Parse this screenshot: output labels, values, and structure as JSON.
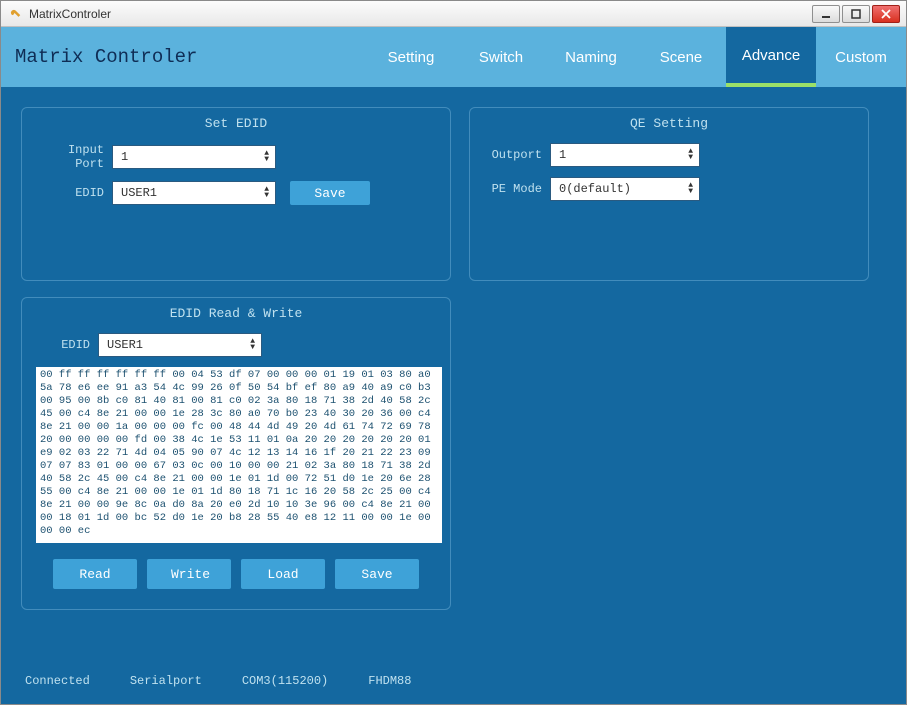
{
  "window": {
    "title": "MatrixControler"
  },
  "brand": "Matrix Controler",
  "tabs": [
    {
      "label": "Setting",
      "active": false
    },
    {
      "label": "Switch",
      "active": false
    },
    {
      "label": "Naming",
      "active": false
    },
    {
      "label": "Scene",
      "active": false
    },
    {
      "label": "Advance",
      "active": true
    },
    {
      "label": "Custom",
      "active": false
    }
  ],
  "set_edid": {
    "title": "Set EDID",
    "input_port_label": "Input Port",
    "input_port_value": "1",
    "edid_label": "EDID",
    "edid_value": "USER1",
    "save_label": "Save"
  },
  "qe": {
    "title": "QE Setting",
    "outport_label": "Outport",
    "outport_value": "1",
    "pe_mode_label": "PE Mode",
    "pe_mode_value": "0(default)"
  },
  "rw": {
    "title": "EDID Read & Write",
    "edid_label": "EDID",
    "edid_value": "USER1",
    "hex": "00 ff ff ff ff ff ff 00 04 53 df 07 00 00 00 01 19 01 03 80 a0 5a 78 e6 ee 91 a3 54 4c 99 26 0f 50 54 bf ef 80 a9 40 a9 c0 b3 00 95 00 8b c0 81 40 81 00 81 c0 02 3a 80 18 71 38 2d 40 58 2c 45 00 c4 8e 21 00 00 1e 28 3c 80 a0 70 b0 23 40 30 20 36 00 c4 8e 21 00 00 1a 00 00 00 fc 00 48 44 4d 49 20 4d 61 74 72 69 78 20 00 00 00 00 fd 00 38 4c 1e 53 11 01 0a 20 20 20 20 20 20 01 e9 02 03 22 71 4d 04 05 90 07 4c 12 13 14 16 1f 20 21 22 23 09 07 07 83 01 00 00 67 03 0c 00 10 00 00 21 02 3a 80 18 71 38 2d 40 58 2c 45 00 c4 8e 21 00 00 1e 01 1d 00 72 51 d0 1e 20 6e 28 55 00 c4 8e 21 00 00 1e 01 1d 80 18 71 1c 16 20 58 2c 25 00 c4 8e 21 00 00 9e 8c 0a d0 8a 20 e0 2d 10 10 3e 96 00 c4 8e 21 00 00 18 01 1d 00 bc 52 d0 1e 20 b8 28 55 40 e8 12 11 00 00 1e 00 00 00 ec",
    "read_label": "Read",
    "write_label": "Write",
    "load_label": "Load",
    "save_label": "Save"
  },
  "status": {
    "conn": "Connected",
    "port_type": "Serialport",
    "port_info": "COM3(115200)",
    "model": "FHDM88"
  }
}
